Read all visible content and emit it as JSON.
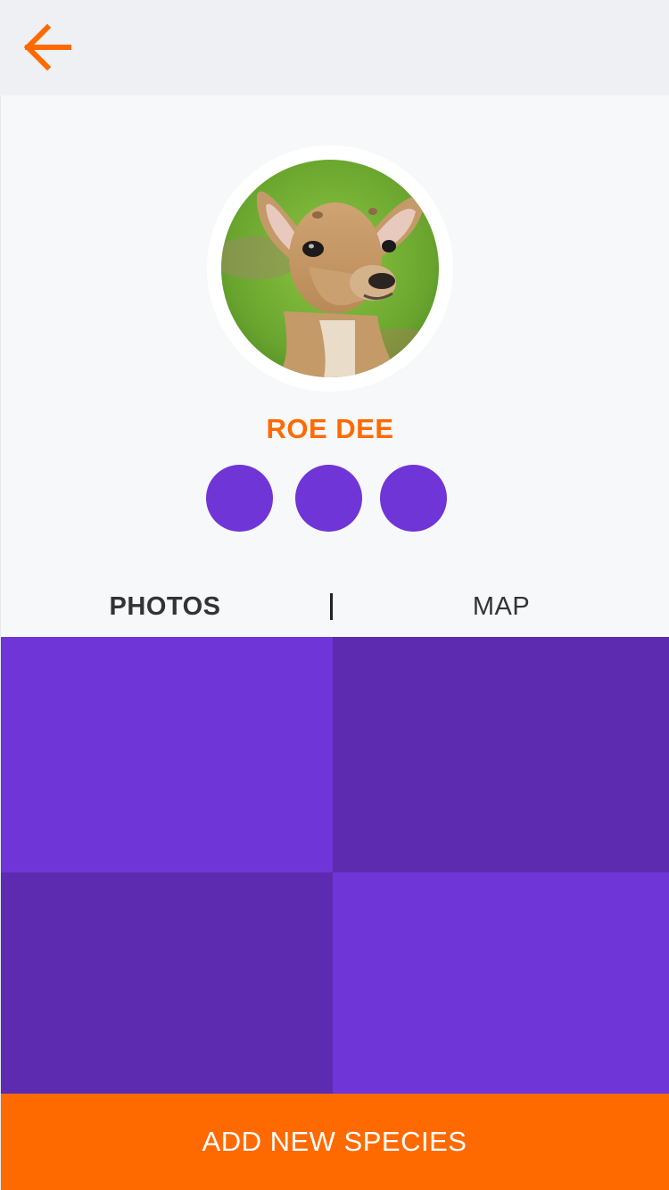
{
  "header": {
    "back_icon": "arrow-left-icon",
    "accent_color": "#ff6a00"
  },
  "profile": {
    "species_name": "ROE DEE",
    "avatar_subject": "roe-deer-photo",
    "badges": [
      {
        "color": "#7035d6"
      },
      {
        "color": "#7035d6"
      },
      {
        "color": "#7035d6"
      }
    ]
  },
  "tabs": [
    {
      "label": "PHOTOS",
      "active": true
    },
    {
      "label": "MAP",
      "active": false
    }
  ],
  "photos": [
    {
      "color": "#7035d6"
    },
    {
      "color": "#5d2bb0"
    },
    {
      "color": "#5d2bb0"
    },
    {
      "color": "#7035d6"
    }
  ],
  "footer": {
    "add_button_label": "ADD NEW SPECIES"
  }
}
